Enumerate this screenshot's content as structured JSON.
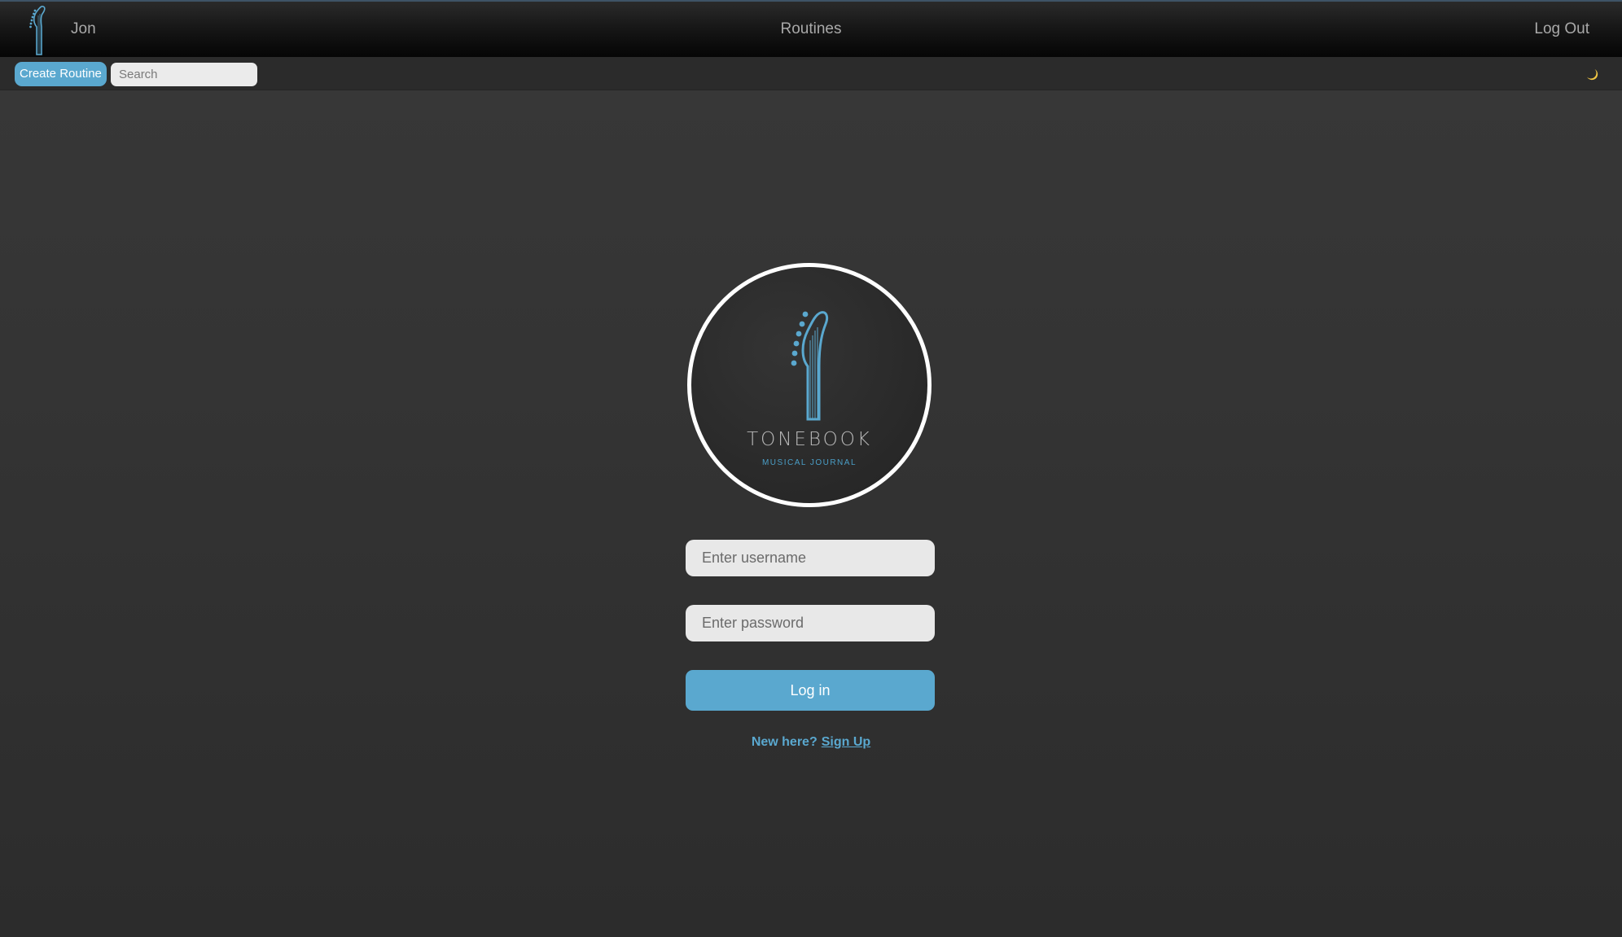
{
  "navbar": {
    "logo_icon": "guitar-headstock-icon",
    "user_name": "Jon",
    "routines_label": "Routines",
    "logout_label": "Log Out"
  },
  "toolbar": {
    "create_label": "Create Routine",
    "search_placeholder": "Search",
    "theme_icon": "moon-icon"
  },
  "login": {
    "logo": {
      "title": "TONEBOOK",
      "subtitle": "MUSICAL JOURNAL"
    },
    "username_placeholder": "Enter username",
    "password_placeholder": "Enter password",
    "submit_label": "Log in",
    "signup_prompt": "New here?",
    "signup_link": "Sign Up"
  },
  "colors": {
    "accent": "#5aa8cf",
    "moon": "#f2c744",
    "background": "#353535",
    "navbar": "#0a0a0a"
  }
}
